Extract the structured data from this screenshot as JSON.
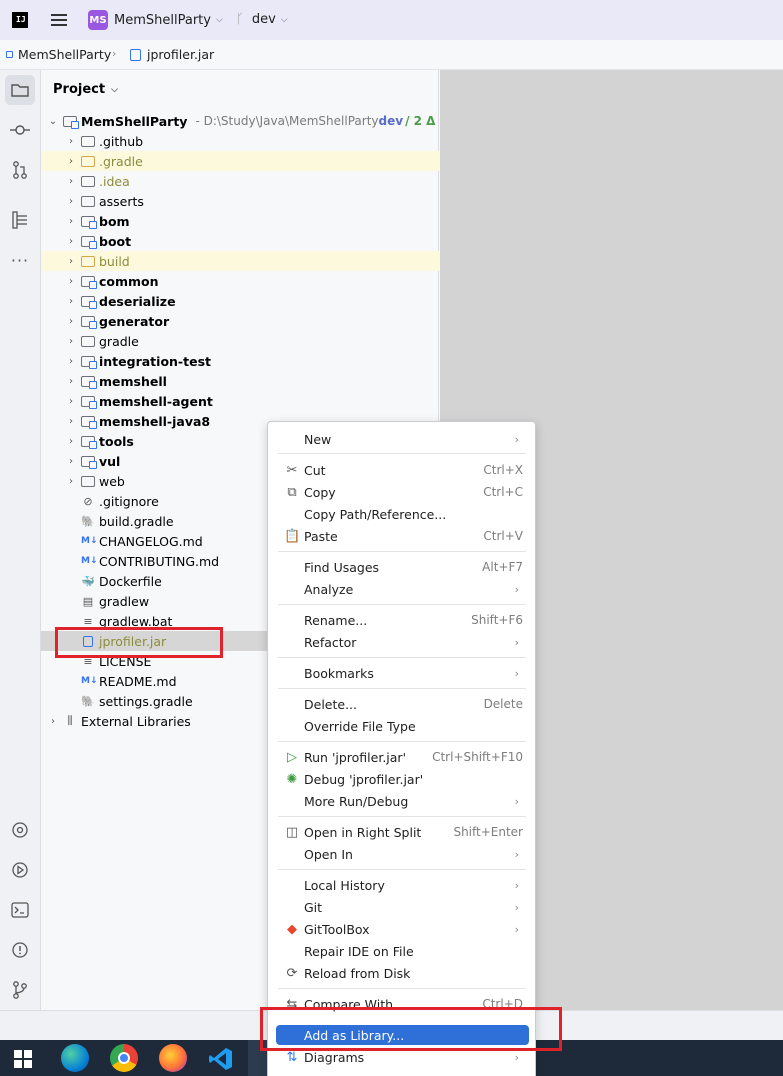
{
  "titlebar": {
    "logo_text": "IJ",
    "project_badge": "MS",
    "project_name": "MemShellParty",
    "branch": "dev"
  },
  "breadcrumb": {
    "project": "MemShellParty",
    "file": "jprofiler.jar"
  },
  "leftbar": {
    "icons": [
      "project-icon",
      "commit-icon",
      "pull-requests-icon",
      "structure-icon",
      "more-icon",
      "services-icon",
      "run-icon",
      "terminal-icon",
      "problems-icon",
      "git-icon"
    ]
  },
  "panel": {
    "title": "Project",
    "root": {
      "name": "MemShellParty",
      "path": "- D:\\Study\\Java\\MemShellParty",
      "branch": "dev",
      "changes": "/ 2 Δ"
    },
    "items": [
      {
        "label": ".github"
      },
      {
        "label": ".gradle"
      },
      {
        "label": ".idea"
      },
      {
        "label": "asserts"
      },
      {
        "label": "bom"
      },
      {
        "label": "boot"
      },
      {
        "label": "build"
      },
      {
        "label": "common"
      },
      {
        "label": "deserialize"
      },
      {
        "label": "generator"
      },
      {
        "label": "gradle"
      },
      {
        "label": "integration-test"
      },
      {
        "label": "memshell"
      },
      {
        "label": "memshell-agent"
      },
      {
        "label": "memshell-java8"
      },
      {
        "label": "tools"
      },
      {
        "label": "vul"
      },
      {
        "label": "web"
      },
      {
        "label": ".gitignore"
      },
      {
        "label": "build.gradle"
      },
      {
        "label": "CHANGELOG.md"
      },
      {
        "label": "CONTRIBUTING.md"
      },
      {
        "label": "Dockerfile"
      },
      {
        "label": "gradlew"
      },
      {
        "label": "gradlew.bat"
      },
      {
        "label": "jprofiler.jar"
      },
      {
        "label": "LICENSE"
      },
      {
        "label": "README.md"
      },
      {
        "label": "settings.gradle"
      },
      {
        "label": "External Libraries"
      }
    ]
  },
  "context_menu": {
    "items": [
      {
        "label": "New",
        "shortcut": ""
      },
      {
        "label": "Cut",
        "shortcut": "Ctrl+X"
      },
      {
        "label": "Copy",
        "shortcut": "Ctrl+C"
      },
      {
        "label": "Copy Path/Reference...",
        "shortcut": ""
      },
      {
        "label": "Paste",
        "shortcut": "Ctrl+V"
      },
      {
        "label": "Find Usages",
        "shortcut": "Alt+F7"
      },
      {
        "label": "Analyze",
        "shortcut": ""
      },
      {
        "label": "Rename...",
        "shortcut": "Shift+F6"
      },
      {
        "label": "Refactor",
        "shortcut": ""
      },
      {
        "label": "Bookmarks",
        "shortcut": ""
      },
      {
        "label": "Delete...",
        "shortcut": "Delete"
      },
      {
        "label": "Override File Type",
        "shortcut": ""
      },
      {
        "label": "Run 'jprofiler.jar'",
        "shortcut": "Ctrl+Shift+F10"
      },
      {
        "label": "Debug 'jprofiler.jar'",
        "shortcut": ""
      },
      {
        "label": "More Run/Debug",
        "shortcut": ""
      },
      {
        "label": "Open in Right Split",
        "shortcut": "Shift+Enter"
      },
      {
        "label": "Open In",
        "shortcut": ""
      },
      {
        "label": "Local History",
        "shortcut": ""
      },
      {
        "label": "Git",
        "shortcut": ""
      },
      {
        "label": "GitToolBox",
        "shortcut": ""
      },
      {
        "label": "Repair IDE on File",
        "shortcut": ""
      },
      {
        "label": "Reload from Disk",
        "shortcut": ""
      },
      {
        "label": "Compare With...",
        "shortcut": "Ctrl+D"
      },
      {
        "label": "Add as Library...",
        "shortcut": ""
      },
      {
        "label": "Diagrams",
        "shortcut": ""
      }
    ]
  },
  "taskbar": {
    "apps": [
      "windows-start-icon",
      "edge-icon",
      "chrome-icon",
      "firefox-icon",
      "vscode-icon",
      "intellij-icon"
    ]
  },
  "colors": {
    "accent": "#2f6fd8",
    "highlight_box": "#e0222a",
    "ignored_folder_bg": "#fcf9dc"
  }
}
